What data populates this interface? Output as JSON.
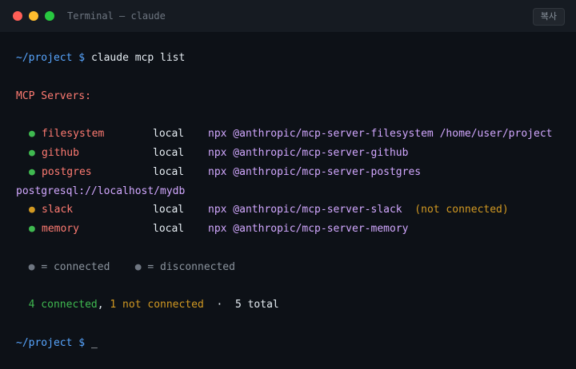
{
  "window": {
    "title": "Terminal — claude",
    "copy_button": "복사"
  },
  "prompt": {
    "path": "~/project",
    "symbol": "$",
    "command": "claude mcp list"
  },
  "heading": "MCP Servers:",
  "servers": [
    {
      "bullet": "●",
      "name": "filesystem",
      "scope": "local",
      "command": "npx @anthropic/mcp-server-filesystem /home/user/project",
      "status": "connected"
    },
    {
      "bullet": "●",
      "name": "github",
      "scope": "local",
      "command": "npx @anthropic/mcp-server-github",
      "status": "connected"
    },
    {
      "bullet": "●",
      "name": "postgres",
      "scope": "local",
      "command": "npx @anthropic/mcp-server-postgres",
      "command_wrap": "postgresql://localhost/mydb",
      "status": "connected"
    },
    {
      "bullet": "●",
      "name": "slack",
      "scope": "local",
      "command": "npx @anthropic/mcp-server-slack",
      "note": "(not connected)",
      "status": "disconnected"
    },
    {
      "bullet": "●",
      "name": "memory",
      "scope": "local",
      "command": "npx @anthropic/mcp-server-memory",
      "status": "connected"
    }
  ],
  "legend": {
    "connected_bullet": "●",
    "connected_label": "= connected",
    "disconnected_bullet": "●",
    "disconnected_label": "= disconnected"
  },
  "summary": {
    "connected": "4 connected",
    "comma": ",",
    "not_connected": "1 not connected",
    "separator": "·",
    "total": "5 total"
  },
  "final_prompt": {
    "path": "~/project",
    "symbol": "$",
    "cursor": "_"
  },
  "colors": {
    "background": "#0d1117",
    "titlebar": "#161b22",
    "path": "#58a6ff",
    "heading": "#ff7b72",
    "connected": "#3fb950",
    "disconnected": "#d29922",
    "command": "#d2a8ff"
  }
}
